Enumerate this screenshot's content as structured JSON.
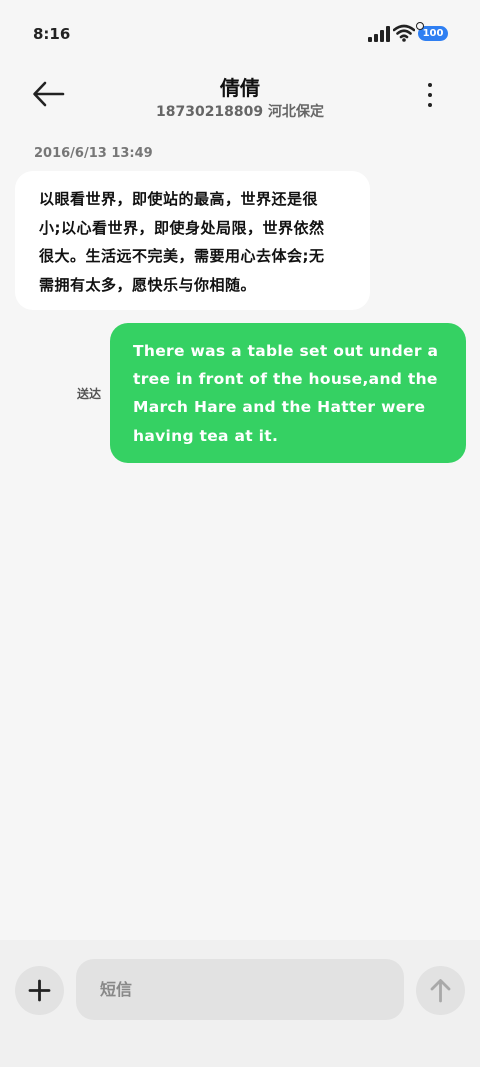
{
  "status_bar": {
    "time": "8:16",
    "battery_level": "100",
    "icons": [
      "signal-icon",
      "wifi-icon",
      "battery-icon"
    ]
  },
  "header": {
    "title": "倩倩",
    "subtitle": "18730218809 河北保定",
    "icons": [
      "back-arrow-icon",
      "more-vertical-icon"
    ]
  },
  "conversation": {
    "timestamp": "2016/6/13 13:49",
    "messages": [
      {
        "direction": "incoming",
        "lines": [
          "以眼看世界，即使站的最高，世界还是很",
          "小;以心看世界，即使身处局限，世界依然",
          "很大。生活远不完美，需要用心去体会;无",
          "需拥有太多，愿快乐与你相随。"
        ]
      },
      {
        "direction": "outgoing",
        "status": "送达",
        "lines": [
          "There was a table set out under a",
          "tree in front of the house,and the",
          "March Hare and the Hatter were",
          "having tea at it."
        ]
      }
    ]
  },
  "composer": {
    "placeholder": "短信",
    "icons": [
      "plus-icon",
      "send-arrow-icon"
    ]
  },
  "colors": {
    "outgoing_bubble": "#35d163",
    "incoming_bubble": "#ffffff",
    "battery": "#2f7ff2",
    "background": "#f6f6f6"
  }
}
